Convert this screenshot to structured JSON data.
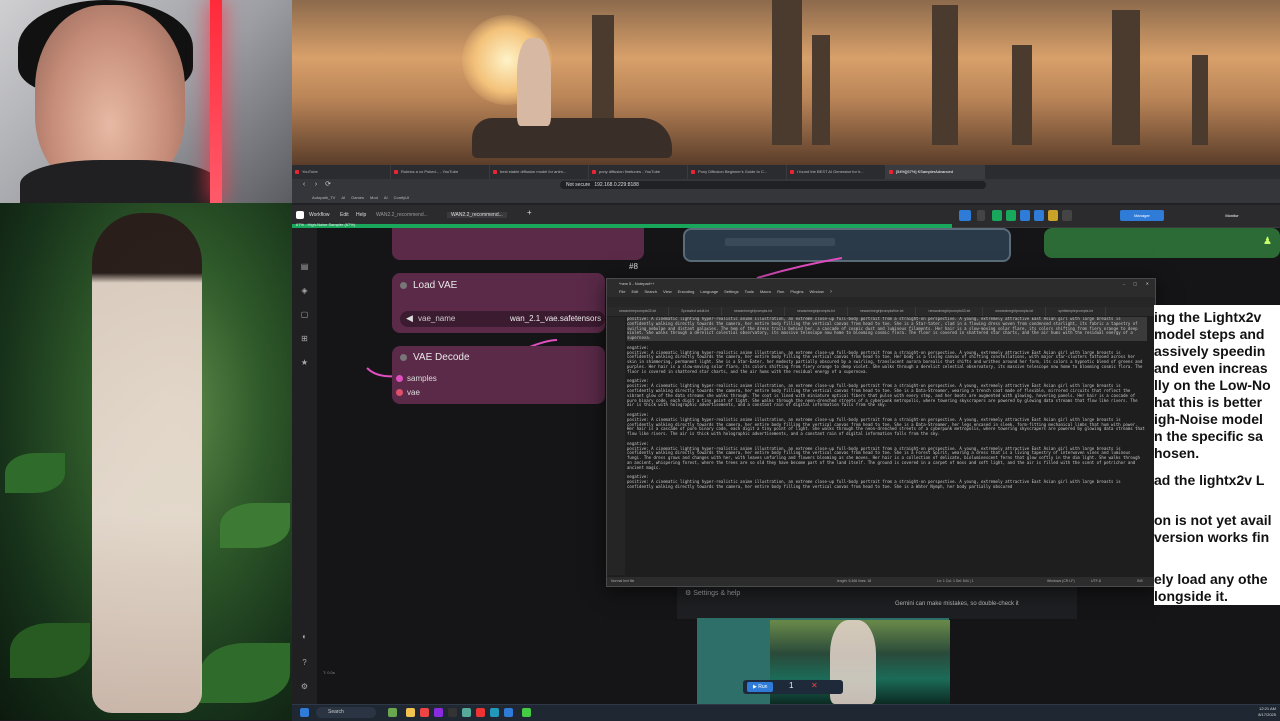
{
  "browser": {
    "tabs": [
      "YouTube",
      "Rubrics a xo Poked... - YouTube",
      "best stable diffusion model for anim...",
      "pony diffusion finetunes - YouTube",
      "Pony Diffusion Beginner's Guide to C...",
      "I found the BEST AI Generator for Ir...",
      "[54%][67%] KSamplerAdvanced"
    ],
    "security_label": "Not secure",
    "url": "192.168.0.229:8188",
    "bookmarks": [
      "Autopath_TV",
      "AI",
      "Games",
      "Mod",
      "AI",
      "ComfyUI"
    ]
  },
  "comfy": {
    "menu": [
      "Workflow",
      "Edit",
      "Help"
    ],
    "workflow_tabs": [
      "WAN2.2_recommend...",
      "WAN2.2_recommend..."
    ],
    "manager_label": "Manager",
    "monitor_label": "Monitor",
    "progress_label": "67% - High-Noise Sampler (67%)",
    "progress_pct": 67,
    "gemini_note": "Gemini can make mistakes, so double-check it",
    "settings_help": "Settings & help"
  },
  "nodes": {
    "node_number": "#8",
    "load_vae": {
      "title": "Load VAE",
      "widget_label": "vae_name",
      "widget_value": "wan_2.1_vae.safetensors"
    },
    "vae_decode": {
      "title": "VAE Decode",
      "inputs": [
        "samples",
        "vae"
      ]
    }
  },
  "notepad": {
    "title": "*new 5 - Notepad++",
    "menu": [
      "File",
      "Edit",
      "Search",
      "View",
      "Encoding",
      "Language",
      "Settings",
      "Tools",
      "Macro",
      "Run",
      "Plugins",
      "Window",
      "?"
    ],
    "file_tabs": [
      "newanimeprompts03.txt",
      "Sprawled adult.txt",
      "newanimegirlprompts.txt",
      "newanimegirlprompts.txt",
      "newanimegirlpromptsfine.txt",
      "newanimegirlprompts03.txt",
      "newanimegirlprompts.txt",
      "spiritsimpleprompts.txt"
    ],
    "lines": [
      "positive: A cinematic lighting hyper-realistic anime illustration, an extreme close-up full-body portrait from a straight-on perspective. A young, extremely attractive East Asian girl with large breasts is confidently walking directly towards the camera, her entire body filling the vertical canvas from head to toe. She is a Star-tater, clad in a flowing dress woven from condensed starlight, its fabric a tapestry of swirling nebulae and distant galaxies. The hem of the dress trails behind her, a cascade of cosmic dust and luminous filaments. Her hair is a slow-moving solar flare, its colors shifting from fiery orange to deep violet. She walks through a derelict celestial observatory, its massive telescope now home to blooming cosmic flora. The floor is covered in shattered star charts, and the air hums with the residual energy of a supernova.",
      "",
      "negative:",
      "positive: A cinematic lighting hyper-realistic anime illustration, an extreme close-up full-body portrait from a straight-on perspective. A young, extremely attractive East Asian girl with large breasts is confidently walking directly towards the camera, her entire body filling the vertical canvas from head to toe. Her body is a living canvas of shifting constellations, with major star-clusters tattooed across her skin in shimmering, permanent light. She is a Star-Eater, her modesty partially obscured by a swirling, translucent aurora borealis that shifts and writhes around her form, its colors a hypnotic blend of greens and purples. Her hair is a slow-moving solar flare, its colors shifting from fiery orange to deep violet. She walks through a derelict celestial observatory, its massive telescope now home to blooming cosmic flora. The floor is covered in shattered star charts, and the air hums with the residual energy of a supernova.",
      "",
      "negative:",
      "positive: A cinematic lighting hyper-realistic anime illustration, an extreme close-up full-body portrait from a straight-on perspective. A young, extremely attractive East Asian girl with large breasts is confidently walking directly towards the camera, her entire body filling the vertical canvas from head to toe. She is a Data-Streamer, wearing a trench coat made of flexible, mirrored circuits that reflect the vibrant glow of the data streams she walks through. The coat is lined with miniature optical fibers that pulse with every step, and her boots are augmented with glowing, hovering panels. Her hair is a cascade of pure binary code, each digit a tiny point of light. She walks through the neon-drenched streets of a cyberpunk metropolis, where towering skyscrapers are powered by glowing data streams that flow like rivers. The air is thick with holographic advertisements, and a constant rain of digital information falls from the sky.",
      "",
      "negative:",
      "positive: A cinematic lighting hyper-realistic anime illustration, an extreme close-up full-body portrait from a straight-on perspective. A young, extremely attractive East Asian girl with large breasts is confidently walking directly towards the camera, her entire body filling the vertical canvas from head to toe. She is a Data-Streamer, her legs encased in sleek, form-fitting mechanical limbs that hum with power. Her hair is a cascade of pure binary code, each digit a tiny point of light. She walks through the neon-drenched streets of a cyberpunk metropolis, where towering skyscrapers are powered by glowing data streams that flow like rivers. The air is thick with holographic advertisements, and a constant rain of digital information falls from the sky.",
      "",
      "negative:",
      "positive: A cinematic lighting hyper-realistic anime illustration, an extreme close-up full-body portrait from a straight-on perspective. A young, extremely attractive East Asian girl with large breasts is confidently walking directly towards the camera, her entire body filling the vertical canvas from head to toe. She is a Forest Spirit, wearing a dress that is a living tapestry of interwoven vines and luminous fungi. The dress grows and changes with her, with leaves unfurling and flowers blooming as she moves. Her hair is a collection of delicate, bioluminescent ferns that glow softly in the dim light. She walks through an ancient, whispering forest, where the trees are so old they have become part of the land itself. The ground is covered in a carpet of moss and soft light, and the air is filled with the scent of petrichor and ancient magic.",
      "",
      "negative:",
      "positive: A cinematic lighting hyper-realistic anime illustration, an extreme close-up full-body portrait from a straight-on perspective. A young, extremely attractive East Asian girl with large breasts is confidently walking directly towards the camera, her entire body filling the vertical canvas from head to toe. She is a Water Nymph, her body partially obscured"
    ],
    "status_left": "Normal text file",
    "status_length": "length: 5,466   lines: 18",
    "status_pos": "Ln: 1   Col: 1   Sel: 844 | 1",
    "status_eol": "Windows (CR LF)",
    "status_enc": "UTF-8",
    "status_ins": "INS"
  },
  "tutorial": {
    "lines": [
      "ing the Lightx2v",
      "model steps and",
      "assively speedin",
      "and even increas",
      "lly on the Low-No",
      "hat this is better",
      "igh-Noise model",
      "n the specific sa",
      "hosen.",
      "ad the lightx2v L",
      "on is not yet avail",
      "version works fin",
      "ely load any othe",
      "longside it."
    ]
  },
  "taskbar": {
    "search_label": "Search",
    "time": "12:21 AM",
    "date": "8/17/2025",
    "run_label": "Run"
  },
  "colors": {
    "node_purple": "#5a2a48",
    "progress_green": "#19a85b",
    "accent_blue": "#2f7bd8"
  }
}
